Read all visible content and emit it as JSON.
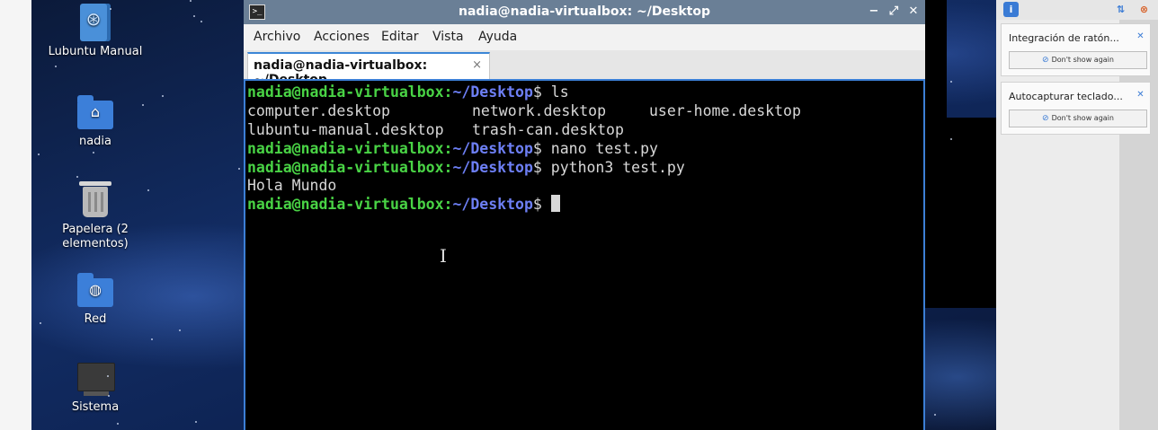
{
  "desktop": {
    "icons": [
      {
        "label": "Lubuntu Manual"
      },
      {
        "label": "nadia"
      },
      {
        "label": "Papelera (2 elementos)"
      },
      {
        "label": "Red"
      },
      {
        "label": "Sistema"
      }
    ]
  },
  "window": {
    "title": "nadia@nadia-virtualbox: ~/Desktop",
    "controls": {
      "minimize": "−",
      "maximize": "⤢",
      "close": "✕"
    },
    "menu": [
      "Archivo",
      "Acciones",
      "Editar",
      "Vista",
      "Ayuda"
    ],
    "tab": {
      "label": "nadia@nadia-virtualbox: ~/Desktop",
      "close": "×"
    }
  },
  "terminal": {
    "prompt_user": "nadia@nadia-virtualbox:",
    "prompt_path": "~/Desktop",
    "prompt_sign": "$ ",
    "commands": [
      "ls",
      "nano test.py",
      "python3 test.py"
    ],
    "ls_output": [
      [
        "computer.desktop",
        "network.desktop",
        "user-home.desktop"
      ],
      [
        "lubuntu-manual.desktop",
        "trash-can.desktop"
      ]
    ],
    "program_output": "Hola Mundo"
  },
  "notifications": [
    {
      "title": "Integración de ratón...",
      "button": "Don't show again"
    },
    {
      "title": "Autocapturar teclado...",
      "button": "Don't show again"
    }
  ],
  "colors": {
    "prompt_user": "#49d345",
    "prompt_path": "#6d7ff5",
    "titlebar": "#6a7f96",
    "tab_accent": "#3b86d6"
  }
}
